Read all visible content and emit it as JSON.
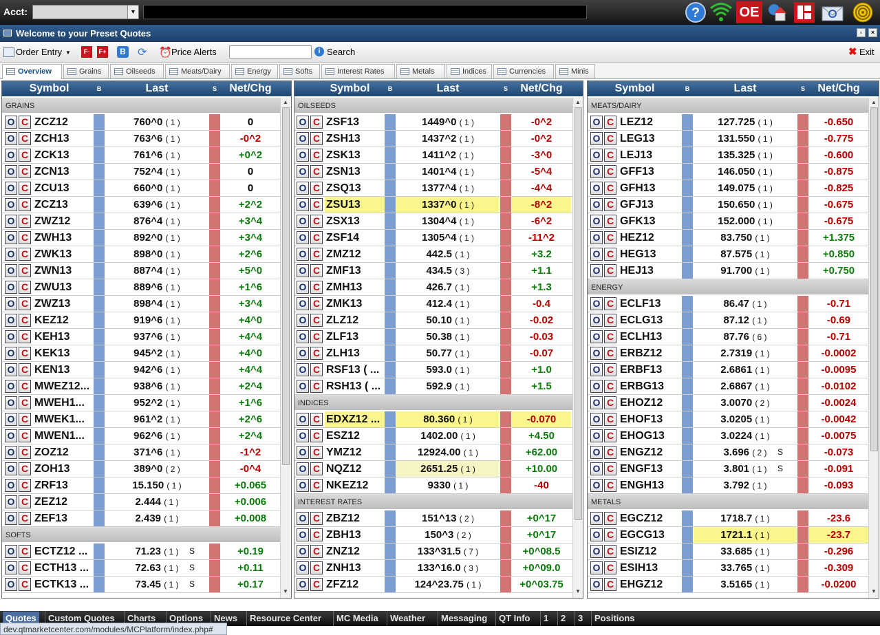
{
  "topbar": {
    "acct_label": "Acct:",
    "oe_label": "OE"
  },
  "window": {
    "title": "Welcome to your Preset Quotes"
  },
  "toolbar": {
    "order_entry": "Order Entry",
    "price_alerts": "Price Alerts",
    "search_label": "Search",
    "search_value": "",
    "exit": "Exit",
    "f_minus": "F-",
    "f_plus": "F+",
    "b_label": "B"
  },
  "tabs": [
    "Overview",
    "Grains",
    "Oilseeds",
    "Meats/Dairy",
    "Energy",
    "Softs",
    "Interest Rates",
    "Metals",
    "Indices",
    "Currencies",
    "Minis"
  ],
  "columns": {
    "symbol": "Symbol",
    "b": "B",
    "last": "Last",
    "s": "S",
    "netchg": "Net/Chg",
    "open_btn": "O",
    "close_btn": "C"
  },
  "panels": [
    {
      "sections": [
        {
          "title": "GRAINS",
          "rows": [
            {
              "sym": "ZCZ12",
              "last": "760^0",
              "size": "( 1 )",
              "chg": "0"
            },
            {
              "sym": "ZCH13",
              "last": "763^6",
              "size": "( 1 )",
              "chg": "-0^2"
            },
            {
              "sym": "ZCK13",
              "last": "761^6",
              "size": "( 1 )",
              "chg": "+0^2"
            },
            {
              "sym": "ZCN13",
              "last": "752^4",
              "size": "( 1 )",
              "chg": "0"
            },
            {
              "sym": "ZCU13",
              "last": "660^0",
              "size": "( 1 )",
              "chg": "0"
            },
            {
              "sym": "ZCZ13",
              "last": "639^6",
              "size": "( 1 )",
              "chg": "+2^2"
            },
            {
              "sym": "ZWZ12",
              "last": "876^4",
              "size": "( 1 )",
              "chg": "+3^4"
            },
            {
              "sym": "ZWH13",
              "last": "892^0",
              "size": "( 1 )",
              "chg": "+3^4"
            },
            {
              "sym": "ZWK13",
              "last": "898^0",
              "size": "( 1 )",
              "chg": "+2^6"
            },
            {
              "sym": "ZWN13",
              "last": "887^4",
              "size": "( 1 )",
              "chg": "+5^0"
            },
            {
              "sym": "ZWU13",
              "last": "889^6",
              "size": "( 1 )",
              "chg": "+1^6"
            },
            {
              "sym": "ZWZ13",
              "last": "898^4",
              "size": "( 1 )",
              "chg": "+3^4"
            },
            {
              "sym": "KEZ12",
              "last": "919^6",
              "size": "( 1 )",
              "chg": "+4^0"
            },
            {
              "sym": "KEH13",
              "last": "937^6",
              "size": "( 1 )",
              "chg": "+4^4"
            },
            {
              "sym": "KEK13",
              "last": "945^2",
              "size": "( 1 )",
              "chg": "+4^0"
            },
            {
              "sym": "KEN13",
              "last": "942^6",
              "size": "( 1 )",
              "chg": "+4^4"
            },
            {
              "sym": "MWEZ12...",
              "last": "938^6",
              "size": "( 1 )",
              "chg": "+2^4"
            },
            {
              "sym": "MWEH1...",
              "last": "952^2",
              "size": "( 1 )",
              "chg": "+1^6"
            },
            {
              "sym": "MWEK1...",
              "last": "961^2",
              "size": "( 1 )",
              "chg": "+2^6"
            },
            {
              "sym": "MWEN1...",
              "last": "962^6",
              "size": "( 1 )",
              "chg": "+2^4"
            },
            {
              "sym": "ZOZ12",
              "last": "371^6",
              "size": "( 1 )",
              "chg": "-1^2"
            },
            {
              "sym": "ZOH13",
              "last": "389^0",
              "size": "( 2 )",
              "chg": "-0^4"
            },
            {
              "sym": "ZRF13",
              "last": "15.150",
              "size": "( 1 )",
              "chg": "+0.065"
            },
            {
              "sym": "ZEZ12",
              "last": "2.444",
              "size": "( 1 )",
              "chg": "+0.006"
            },
            {
              "sym": "ZEF13",
              "last": "2.439",
              "size": "( 1 )",
              "chg": "+0.008"
            }
          ]
        },
        {
          "title": "SOFTS",
          "rows": [
            {
              "sym": "ECTZ12 ...",
              "last": "71.23",
              "size": "( 1 )",
              "flag": "S",
              "chg": "+0.19"
            },
            {
              "sym": "ECTH13 ...",
              "last": "72.63",
              "size": "( 1 )",
              "flag": "S",
              "chg": "+0.11"
            },
            {
              "sym": "ECTK13 ...",
              "last": "73.45",
              "size": "( 1 )",
              "flag": "S",
              "chg": "+0.17"
            }
          ]
        }
      ]
    },
    {
      "sections": [
        {
          "title": "OILSEEDS",
          "rows": [
            {
              "sym": "ZSF13",
              "last": "1449^0",
              "size": "( 1 )",
              "chg": "-0^2"
            },
            {
              "sym": "ZSH13",
              "last": "1437^2",
              "size": "( 1 )",
              "chg": "-0^2"
            },
            {
              "sym": "ZSK13",
              "last": "1411^2",
              "size": "( 1 )",
              "chg": "-3^0"
            },
            {
              "sym": "ZSN13",
              "last": "1401^4",
              "size": "( 1 )",
              "chg": "-5^4"
            },
            {
              "sym": "ZSQ13",
              "last": "1377^4",
              "size": "( 1 )",
              "chg": "-4^4"
            },
            {
              "sym": "ZSU13",
              "last": "1337^0",
              "size": "( 1 )",
              "chg": "-8^2",
              "hl": "row"
            },
            {
              "sym": "ZSX13",
              "last": "1304^4",
              "size": "( 1 )",
              "chg": "-6^2"
            },
            {
              "sym": "ZSF14",
              "last": "1305^4",
              "size": "( 1 )",
              "chg": "-11^2"
            },
            {
              "sym": "ZMZ12",
              "last": "442.5",
              "size": "( 1 )",
              "chg": "+3.2"
            },
            {
              "sym": "ZMF13",
              "last": "434.5",
              "size": "( 3 )",
              "chg": "+1.1"
            },
            {
              "sym": "ZMH13",
              "last": "426.7",
              "size": "( 1 )",
              "chg": "+1.3"
            },
            {
              "sym": "ZMK13",
              "last": "412.4",
              "size": "( 1 )",
              "chg": "-0.4"
            },
            {
              "sym": "ZLZ12",
              "last": "50.10",
              "size": "( 1 )",
              "chg": "-0.02"
            },
            {
              "sym": "ZLF13",
              "last": "50.38",
              "size": "( 1 )",
              "chg": "-0.03"
            },
            {
              "sym": "ZLH13",
              "last": "50.77",
              "size": "( 1 )",
              "chg": "-0.07"
            },
            {
              "sym": "RSF13 ( ...",
              "last": "593.0",
              "size": "( 1 )",
              "chg": "+1.0"
            },
            {
              "sym": "RSH13 ( ...",
              "last": "592.9",
              "size": "( 1 )",
              "chg": "+1.5"
            }
          ]
        },
        {
          "title": "INDICES",
          "rows": [
            {
              "sym": "EDXZ12 ...",
              "last": "80.360",
              "size": "( 1 )",
              "chg": "-0.070",
              "hl": "row"
            },
            {
              "sym": "ESZ12",
              "last": "1402.00",
              "size": "( 1 )",
              "chg": "+4.50"
            },
            {
              "sym": "YMZ12",
              "last": "12924.00",
              "size": "( 1 )",
              "chg": "+62.00"
            },
            {
              "sym": "NQZ12",
              "last": "2651.25",
              "size": "( 1 )",
              "chg": "+10.00",
              "hl": "last"
            },
            {
              "sym": "NKEZ12",
              "last": "9330",
              "size": "( 1 )",
              "chg": "-40"
            }
          ]
        },
        {
          "title": "INTEREST RATES",
          "rows": [
            {
              "sym": "ZBZ12",
              "last": "151^13",
              "size": "( 2 )",
              "chg": "+0^17"
            },
            {
              "sym": "ZBH13",
              "last": "150^3",
              "size": "( 2 )",
              "chg": "+0^17"
            },
            {
              "sym": "ZNZ12",
              "last": "133^31.5",
              "size": "( 7 )",
              "chg": "+0^08.5"
            },
            {
              "sym": "ZNH13",
              "last": "133^16.0",
              "size": "( 3 )",
              "chg": "+0^09.0"
            },
            {
              "sym": "ZFZ12",
              "last": "124^23.75",
              "size": "( 1 )",
              "chg": "+0^03.75"
            }
          ]
        }
      ]
    },
    {
      "sections": [
        {
          "title": "MEATS/DAIRY",
          "rows": [
            {
              "sym": "LEZ12",
              "last": "127.725",
              "size": "( 1 )",
              "chg": "-0.650"
            },
            {
              "sym": "LEG13",
              "last": "131.550",
              "size": "( 1 )",
              "chg": "-0.775"
            },
            {
              "sym": "LEJ13",
              "last": "135.325",
              "size": "( 1 )",
              "chg": "-0.600"
            },
            {
              "sym": "GFF13",
              "last": "146.050",
              "size": "( 1 )",
              "chg": "-0.875"
            },
            {
              "sym": "GFH13",
              "last": "149.075",
              "size": "( 1 )",
              "chg": "-0.825"
            },
            {
              "sym": "GFJ13",
              "last": "150.650",
              "size": "( 1 )",
              "chg": "-0.675"
            },
            {
              "sym": "GFK13",
              "last": "152.000",
              "size": "( 1 )",
              "chg": "-0.675"
            },
            {
              "sym": "HEZ12",
              "last": "83.750",
              "size": "( 1 )",
              "chg": "+1.375"
            },
            {
              "sym": "HEG13",
              "last": "87.575",
              "size": "( 1 )",
              "chg": "+0.850"
            },
            {
              "sym": "HEJ13",
              "last": "91.700",
              "size": "( 1 )",
              "chg": "+0.750"
            }
          ]
        },
        {
          "title": "ENERGY",
          "rows": [
            {
              "sym": "ECLF13",
              "last": "86.47",
              "size": "( 1 )",
              "chg": "-0.71"
            },
            {
              "sym": "ECLG13",
              "last": "87.12",
              "size": "( 1 )",
              "chg": "-0.69"
            },
            {
              "sym": "ECLH13",
              "last": "87.76",
              "size": "( 6 )",
              "chg": "-0.71"
            },
            {
              "sym": "ERBZ12",
              "last": "2.7319",
              "size": "( 1 )",
              "chg": "-0.0002"
            },
            {
              "sym": "ERBF13",
              "last": "2.6861",
              "size": "( 1 )",
              "chg": "-0.0095"
            },
            {
              "sym": "ERBG13",
              "last": "2.6867",
              "size": "( 1 )",
              "chg": "-0.0102"
            },
            {
              "sym": "EHOZ12",
              "last": "3.0070",
              "size": "( 2 )",
              "chg": "-0.0024"
            },
            {
              "sym": "EHOF13",
              "last": "3.0205",
              "size": "( 1 )",
              "chg": "-0.0042"
            },
            {
              "sym": "EHOG13",
              "last": "3.0224",
              "size": "( 1 )",
              "chg": "-0.0075"
            },
            {
              "sym": "ENGZ12",
              "last": "3.696",
              "size": "( 2 )",
              "flag": "S",
              "chg": "-0.073"
            },
            {
              "sym": "ENGF13",
              "last": "3.801",
              "size": "( 1 )",
              "flag": "S",
              "chg": "-0.091"
            },
            {
              "sym": "ENGH13",
              "last": "3.792",
              "size": "( 1 )",
              "chg": "-0.093"
            }
          ]
        },
        {
          "title": "METALS",
          "rows": [
            {
              "sym": "EGCZ12",
              "last": "1718.7",
              "size": "( 1 )",
              "chg": "-23.6"
            },
            {
              "sym": "EGCG13",
              "last": "1721.1",
              "size": "( 1 )",
              "chg": "-23.7",
              "hl": "lastchg"
            },
            {
              "sym": "ESIZ12",
              "last": "33.685",
              "size": "( 1 )",
              "chg": "-0.296"
            },
            {
              "sym": "ESIH13",
              "last": "33.765",
              "size": "( 1 )",
              "chg": "-0.309"
            },
            {
              "sym": "EHGZ12",
              "last": "3.5165",
              "size": "( 1 )",
              "chg": "-0.0200"
            }
          ]
        }
      ]
    }
  ],
  "bottom_tabs": [
    "Quotes",
    "Custom Quotes",
    "Charts",
    "Options",
    "News",
    "Resource Center",
    "MC Media",
    "Weather",
    "Messaging",
    "QT Info",
    "1",
    "2",
    "3",
    "Positions"
  ],
  "status_url": "dev.qtmarketcenter.com/modules/MCPlatform/index.php#",
  "colors": {
    "up": "#0a7a0a",
    "down": "#b40000",
    "b_column": "#7d9ed1",
    "s_column": "#d27373",
    "highlight": "#faf58c"
  }
}
